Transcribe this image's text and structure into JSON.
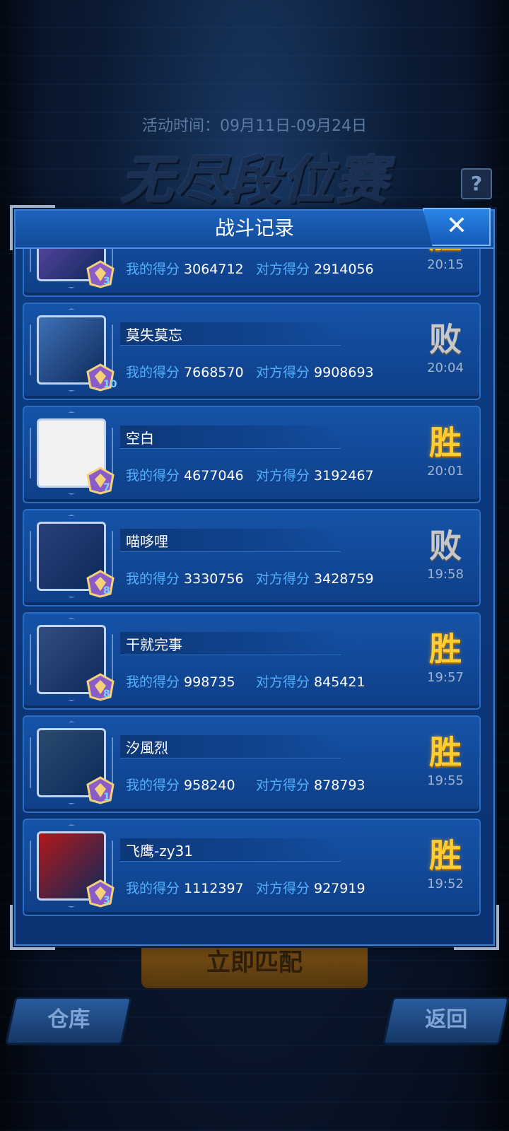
{
  "background": {
    "activity_time": "活动时间：09月11日-09月24日",
    "event_title": "无尽段位赛",
    "help_icon": "?",
    "match_button": "立即匹配",
    "warehouse_button": "仓库",
    "back_button": "返回"
  },
  "modal": {
    "title": "战斗记录",
    "close_icon": "✕"
  },
  "labels": {
    "my_score": "我的得分",
    "opp_score": "对方得分"
  },
  "records": [
    {
      "name": "",
      "my_score": "3064712",
      "opp_score": "2914056",
      "result": "胜",
      "time": "20:15",
      "rank": "3",
      "avatar_color": "#6b4ab3"
    },
    {
      "name": "莫失莫忘",
      "my_score": "7668570",
      "opp_score": "9908693",
      "result": "败",
      "time": "20:04",
      "rank": "10",
      "avatar_color": "#3f6fb6"
    },
    {
      "name": "空白",
      "my_score": "4677046",
      "opp_score": "3192467",
      "result": "胜",
      "time": "20:01",
      "rank": "7",
      "avatar_color": "#f2f2f2"
    },
    {
      "name": "喵哆哩",
      "my_score": "3330756",
      "opp_score": "3428759",
      "result": "败",
      "time": "19:58",
      "rank": "8",
      "avatar_color": "#2a3f7a"
    },
    {
      "name": "干就完事",
      "my_score": "998735",
      "opp_score": "845421",
      "result": "胜",
      "time": "19:57",
      "rank": "8",
      "avatar_color": "#344d80"
    },
    {
      "name": "汐風烈",
      "my_score": "958240",
      "opp_score": "878793",
      "result": "胜",
      "time": "19:55",
      "rank": "1",
      "avatar_color": "#2b4a6e"
    },
    {
      "name": "飞鹰-zy31",
      "my_score": "1112397",
      "opp_score": "927919",
      "result": "胜",
      "time": "19:52",
      "rank": "3",
      "avatar_color": "#b3171b"
    }
  ]
}
